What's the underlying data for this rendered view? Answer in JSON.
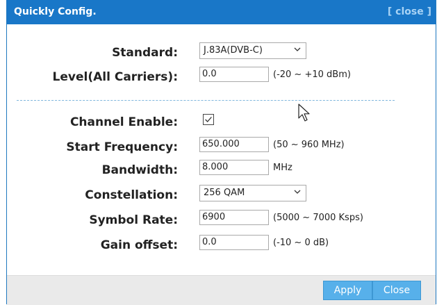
{
  "dialog": {
    "title": "Quickly Config.",
    "close_link": "[ close ]"
  },
  "form": {
    "standard": {
      "label": "Standard:",
      "value": "J.83A(DVB-C)"
    },
    "level": {
      "label": "Level(All Carriers):",
      "value": "0.0",
      "hint": "(-20 ~ +10 dBm)"
    },
    "channel_enable": {
      "label": "Channel Enable:",
      "checked": true
    },
    "start_frequency": {
      "label": "Start Frequency:",
      "value": "650.000",
      "hint": "(50 ~ 960 MHz)"
    },
    "bandwidth": {
      "label": "Bandwidth:",
      "value": "8.000",
      "hint": "MHz"
    },
    "constellation": {
      "label": "Constellation:",
      "value": "256 QAM"
    },
    "symbol_rate": {
      "label": "Symbol Rate:",
      "value": "6900",
      "hint": "(5000 ~ 7000 Ksps)"
    },
    "gain_offset": {
      "label": "Gain offset:",
      "value": "0.0",
      "hint": "(-10 ~ 0 dB)"
    }
  },
  "footer": {
    "apply_label": "Apply",
    "close_label": "Close"
  },
  "colors": {
    "titlebar": "#1977c8",
    "button": "#57b0ea",
    "divider": "#7fb6dd"
  },
  "icons": {
    "dropdown": "chevron-down-icon",
    "checkbox": "checkmark-icon",
    "cursor": "mouse-pointer-icon"
  }
}
